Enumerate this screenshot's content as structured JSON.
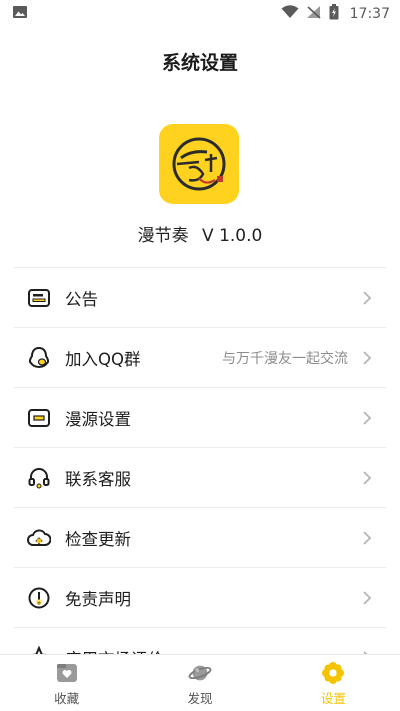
{
  "status_bar": {
    "time": "17:37"
  },
  "header": {
    "title": "系统设置"
  },
  "app": {
    "name": "漫节奏",
    "version": "V 1.0.0"
  },
  "menu": [
    {
      "label": "公告",
      "hint": ""
    },
    {
      "label": "加入QQ群",
      "hint": "与万千漫友一起交流"
    },
    {
      "label": "漫源设置",
      "hint": ""
    },
    {
      "label": "联系客服",
      "hint": ""
    },
    {
      "label": "检查更新",
      "hint": ""
    },
    {
      "label": "免责声明",
      "hint": ""
    },
    {
      "label": "应用市场评价",
      "hint": ""
    }
  ],
  "bottom_nav": [
    {
      "label": "收藏",
      "icon": "heart-folder-icon",
      "active": false
    },
    {
      "label": "发现",
      "icon": "planet-icon",
      "active": false
    },
    {
      "label": "设置",
      "icon": "flower-gear-icon",
      "active": true
    }
  ],
  "colors": {
    "accent": "#ffd21f",
    "active_tab": "#f5c400",
    "icon_dark": "#1e1e1e"
  }
}
